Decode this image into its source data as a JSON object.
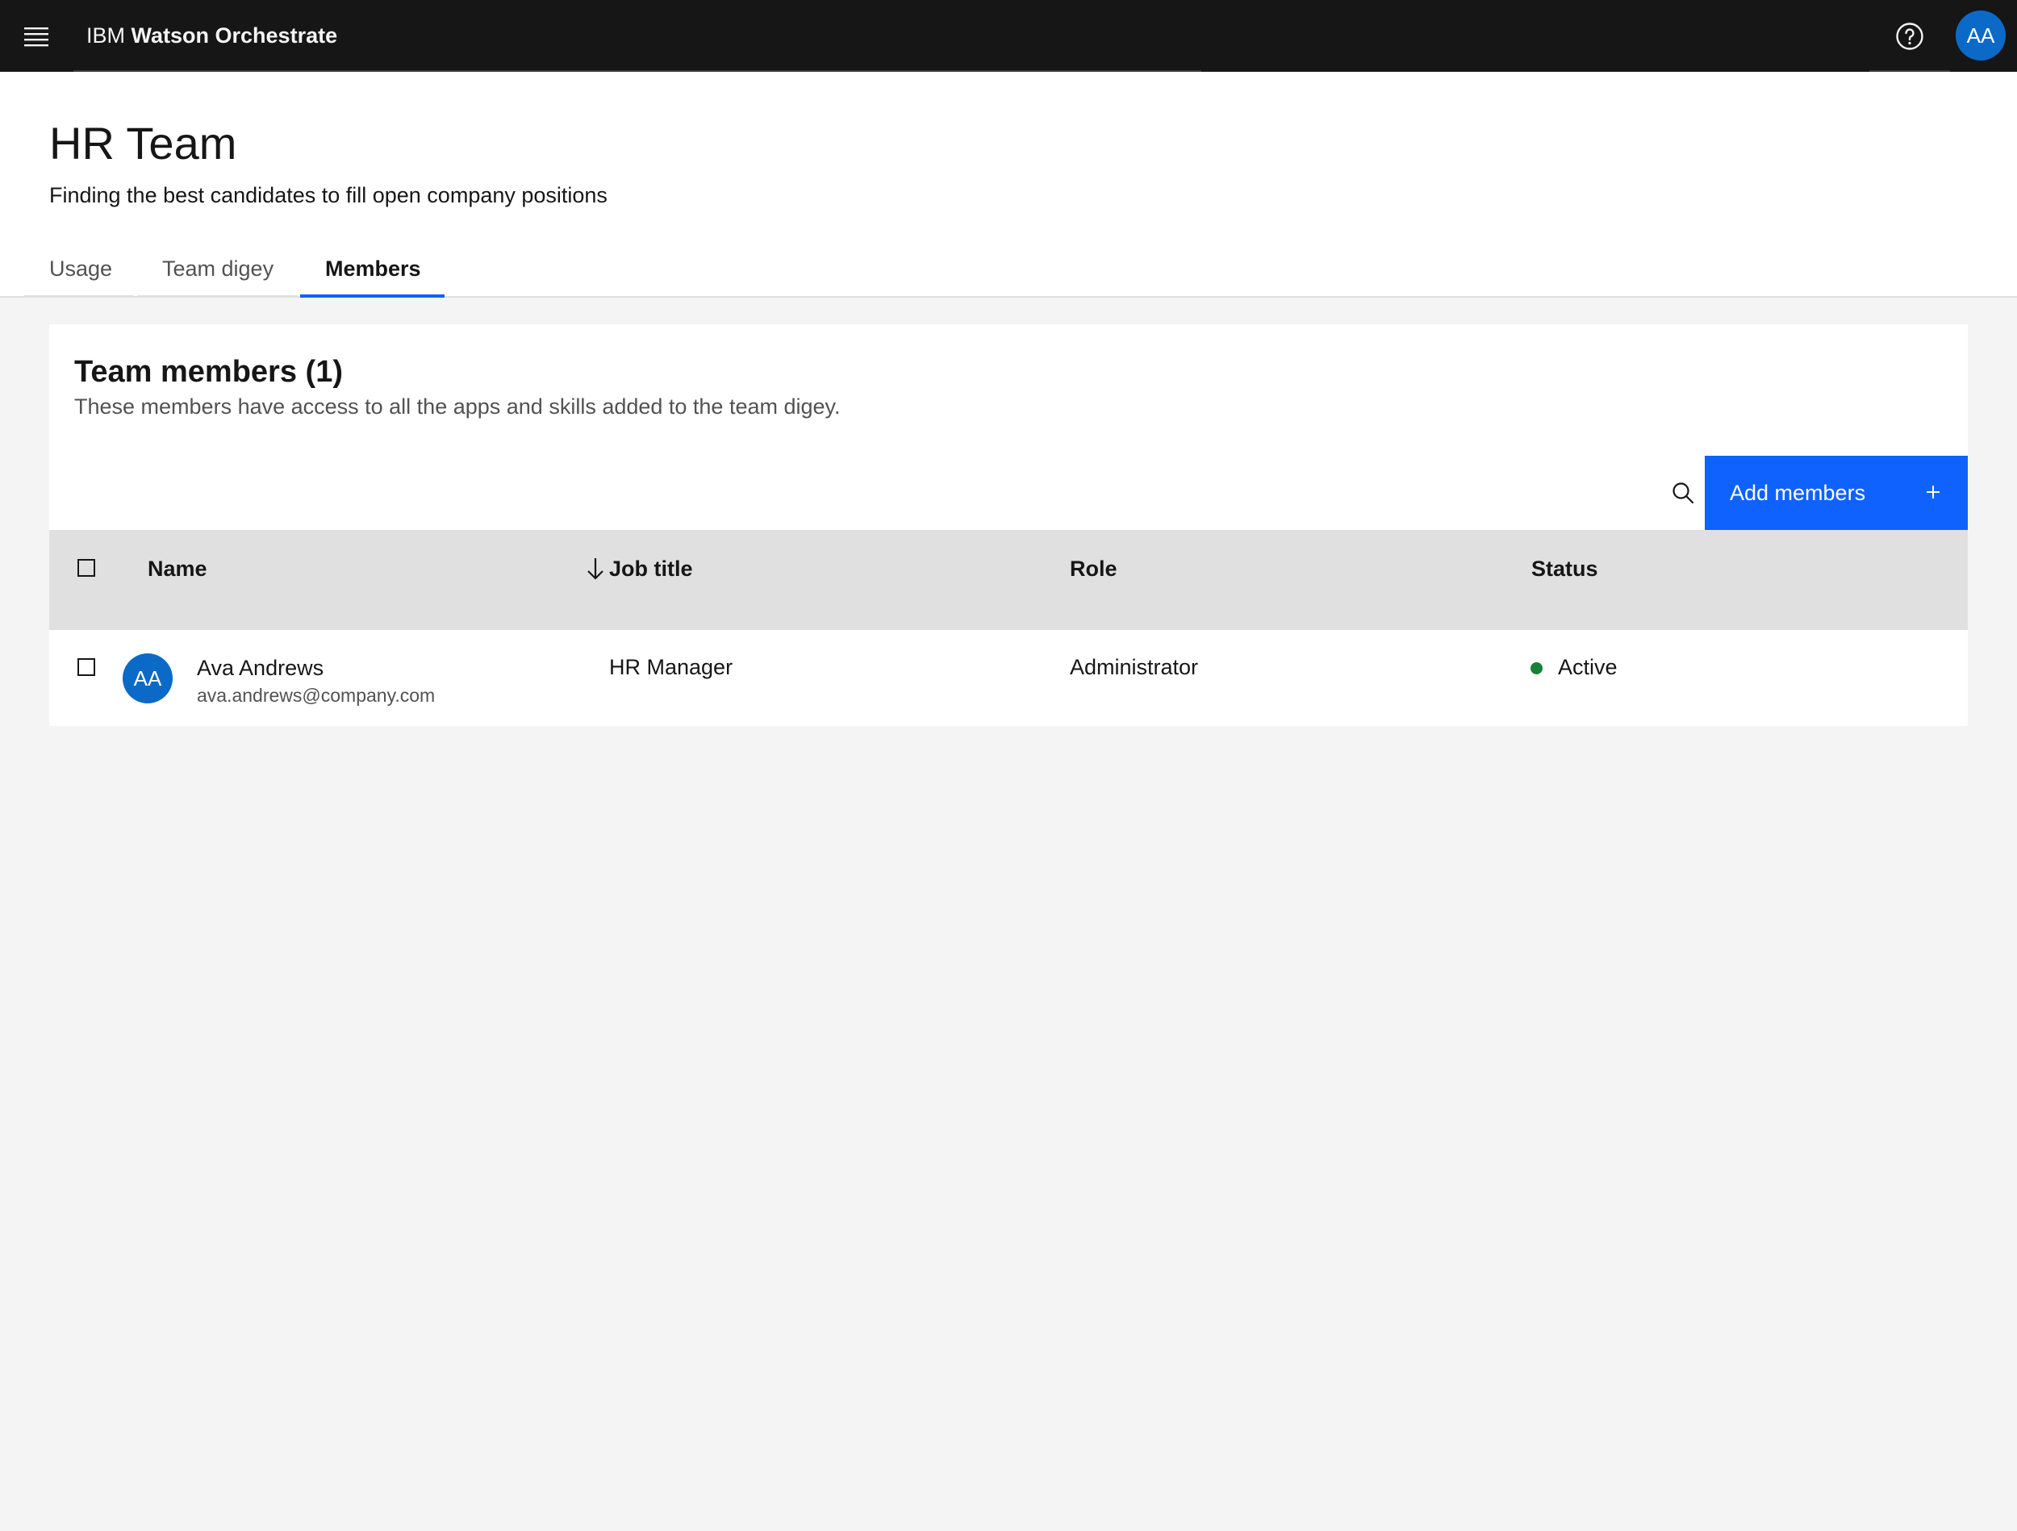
{
  "header": {
    "brand_prefix": "IBM",
    "brand_product": "Watson Orchestrate",
    "avatar_initials": "AA",
    "icons": {
      "menu": "hamburger-menu-icon",
      "help": "help-icon"
    }
  },
  "page": {
    "title": "HR Team",
    "subtitle": "Finding the best candidates to fill open company positions"
  },
  "tabs": [
    {
      "label": "Usage",
      "active": false
    },
    {
      "label": "Team digey",
      "active": false
    },
    {
      "label": "Members",
      "active": true
    }
  ],
  "members_card": {
    "title": "Team members (1)",
    "description": "These members have access to all the apps and skills added to the team digey.",
    "add_button_label": "Add members",
    "icons": {
      "search": "search-icon",
      "add": "plus-icon",
      "sort": "arrow-down-icon"
    }
  },
  "table": {
    "columns": [
      "Name",
      "Job title",
      "Role",
      "Status"
    ],
    "rows": [
      {
        "initials": "AA",
        "name": "Ava Andrews",
        "email": "ava.andrews@company.com",
        "job_title": "HR Manager",
        "role": "Administrator",
        "status": "Active"
      }
    ]
  },
  "colors": {
    "header_bg": "#161616",
    "primary": "#0f62fe",
    "avatar": "#0b6ac7",
    "status_active": "#198038",
    "table_header_bg": "#e0e0e0",
    "page_bg": "#f4f4f4"
  }
}
